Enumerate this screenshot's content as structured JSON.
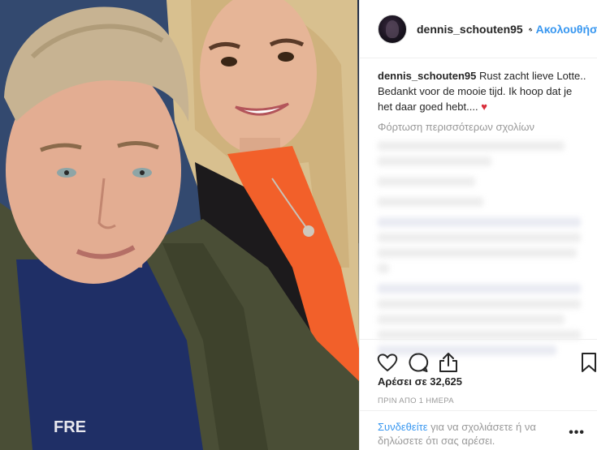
{
  "post": {
    "username": "dennis_schouten95",
    "follow_label": "Ακολουθήστε",
    "separator": "•",
    "caption_text": "Rust zacht lieve Lotte.. Bedankt voor de mooie tijd. Ik hoop dat je het daar goed hebt....",
    "caption_emoji": "♥",
    "load_more_label": "Φόρτωση περισσότερων σχολίων",
    "likes": "Αρέσει σε 32,625",
    "timestamp": "ΠΡΙΝ ΑΠΟ 1 ΗΜΕΡΑ",
    "login_link": "Συνδεθείτε",
    "login_text": " για να σχολιάσετε ή να δηλώσετε ότι σας αρέσει.",
    "more_options": "•••"
  },
  "icons": {
    "verified": "verified-badge-icon",
    "like": "heart-icon",
    "comment": "comment-icon",
    "share": "share-icon",
    "save": "bookmark-icon",
    "more": "more-options-icon"
  },
  "colors": {
    "link": "#3897f0",
    "text": "#262626",
    "muted": "#999999",
    "divider": "#efefef",
    "heart": "#d92d3a"
  }
}
